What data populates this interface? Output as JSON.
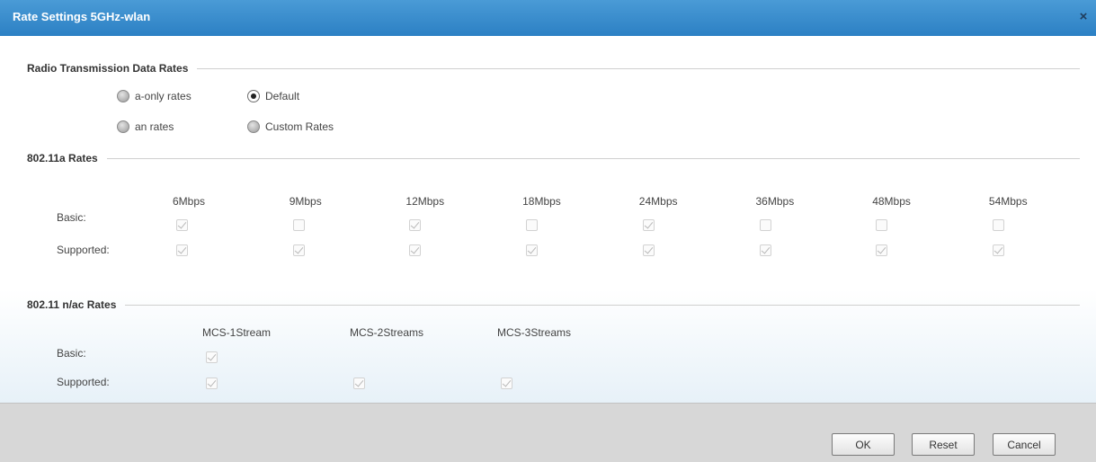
{
  "dialog": {
    "title": "Rate Settings 5GHz-wlan",
    "close_icon": "close-icon",
    "close_glyph": "×"
  },
  "radio_section": {
    "title": "Radio Transmission Data Rates",
    "options": [
      {
        "label": "a-only rates",
        "selected": false
      },
      {
        "label": "Default",
        "selected": true
      },
      {
        "label": "an rates",
        "selected": false
      },
      {
        "label": "Custom Rates",
        "selected": false
      }
    ]
  },
  "a_rates": {
    "title": "802.11a Rates",
    "row_labels": [
      "Basic:",
      "Supported:"
    ],
    "columns": [
      "6Mbps",
      "9Mbps",
      "12Mbps",
      "18Mbps",
      "24Mbps",
      "36Mbps",
      "48Mbps",
      "54Mbps"
    ],
    "basic": [
      true,
      false,
      true,
      false,
      true,
      false,
      false,
      false
    ],
    "supported": [
      true,
      true,
      true,
      true,
      true,
      true,
      true,
      true
    ]
  },
  "n_rates": {
    "title": "802.11 n/ac Rates",
    "row_labels": [
      "Basic:",
      "Supported:"
    ],
    "columns": [
      "MCS-1Stream",
      "MCS-2Streams",
      "MCS-3Streams"
    ],
    "basic": [
      true
    ],
    "supported": [
      true,
      true,
      true
    ]
  },
  "footer": {
    "ok_label": "OK",
    "reset_label": "Reset",
    "cancel_label": "Cancel"
  }
}
